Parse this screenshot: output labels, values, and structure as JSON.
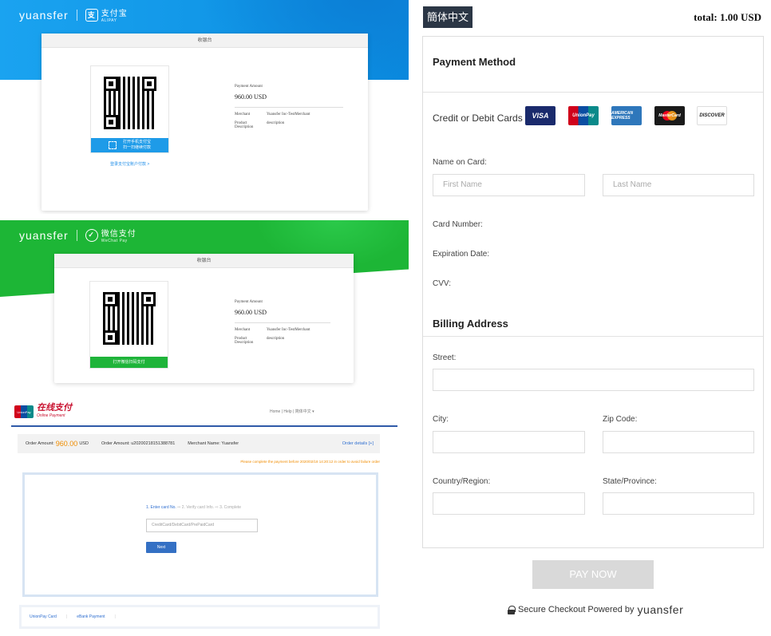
{
  "alipay": {
    "brand": "yuansfer",
    "logo_text": "支付宝",
    "logo_sub": "ALIPAY",
    "title": "收银台",
    "scan_line1": "打开手机支付宝",
    "scan_line2": "扫一扫继续付款",
    "link": "登录支付宝账户付款 >",
    "amount_label": "Payment Amount",
    "amount": "960.00 USD",
    "merchant_label": "Merchant",
    "merchant": "Yuansfer Inc-TestMerchant",
    "desc_label": "Product Description",
    "desc": "description"
  },
  "wechat": {
    "brand": "yuansfer",
    "logo_text": "微信支付",
    "logo_sub": "WeChat Pay",
    "title": "收银台",
    "scan_text": "打开微信扫码支付",
    "amount_label": "Payment Amount",
    "amount": "960.00 USD",
    "merchant_label": "Merchant",
    "merchant": "Yuansfer Inc-TestMerchant",
    "desc_label": "Product Description",
    "desc": "description"
  },
  "unionpay": {
    "logo_text": "在线支付",
    "logo_sub": "Online Payment",
    "card_mark": "UnionPay",
    "nav": "Home  |  Help  |  简体中文 ▾",
    "order_amount_label": "Order Amount:",
    "order_amount": "960.00",
    "order_currency": "USD",
    "order_no": "Order Amount: u20200218151388781",
    "merchant_name": "Merchant Name: Yuansfer",
    "order_details": "Order details [+]",
    "warning": "Please complete the payment before 2020/02/18 14:20:12 in order to avoid failure order",
    "step1": "1. Enter card No.",
    "step2": "2. Verify card Info.",
    "step3": "3. Complete",
    "card_placeholder": "CreditCard/DebitCard/PrePaidCard",
    "next": "Next",
    "tab1": "UnionPay Card",
    "tab2": "eBank Payment"
  },
  "checkout": {
    "lang_button": "簡体中文",
    "total": "total: 1.00 USD",
    "payment_method": "Payment Method",
    "cards_label": "Credit or Debit Cards",
    "card_brands": [
      "VISA",
      "UnionPay",
      "AMERICAN EXPRESS",
      "MasterCard",
      "DISCOVER"
    ],
    "name_label": "Name on Card:",
    "first_name_placeholder": "First Name",
    "last_name_placeholder": "Last Name",
    "card_number_label": "Card Number:",
    "expiration_label": "Expiration Date:",
    "cvv_label": "CVV:",
    "billing_title": "Billing Address",
    "street_label": "Street:",
    "city_label": "City:",
    "zip_label": "Zip Code:",
    "country_label": "Country/Region:",
    "state_label": "State/Province:",
    "pay_button": "PAY NOW",
    "secure_text": "Secure Checkout Powered by",
    "secure_brand": "yuansfer"
  },
  "colors": {
    "alipay_blue": "#1aa3f0",
    "wechat_green": "#1db636",
    "unionpay_blue": "#2f5aa8",
    "dark_button": "#2b3645",
    "disabled_button": "#d9d9d9"
  }
}
